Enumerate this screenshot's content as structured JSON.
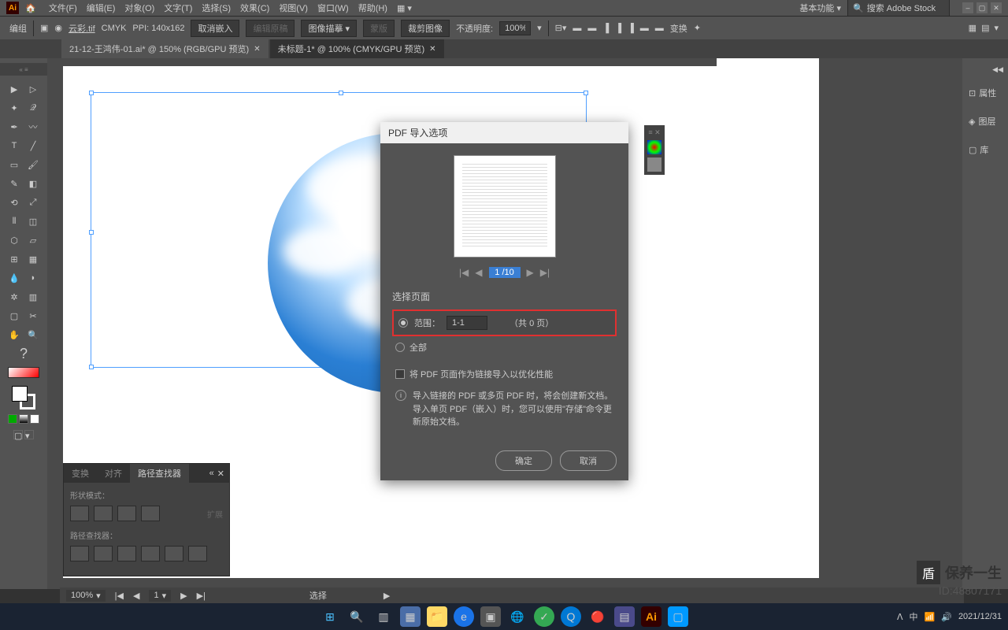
{
  "app": {
    "logo": "Ai"
  },
  "menus": [
    "文件(F)",
    "编辑(E)",
    "对象(O)",
    "文字(T)",
    "选择(S)",
    "效果(C)",
    "视图(V)",
    "窗口(W)",
    "帮助(H)"
  ],
  "titlebar": {
    "workspace": "基本功能",
    "search_placeholder": "搜索 Adobe Stock"
  },
  "controlbar": {
    "label": "编组",
    "filename": "云彩.tif",
    "colormode": "CMYK",
    "ppi": "PPI: 140x162",
    "cancel_embed": "取消嵌入",
    "edit_original": "编辑原稿",
    "image_desc": "图像描摹",
    "trace": "蒙版",
    "crop": "裁剪图像",
    "opacity_label": "不透明度:",
    "opacity_value": "100%",
    "transform": "变换"
  },
  "tabs": [
    {
      "label": "21-12-王鸿伟-01.ai* @ 150% (RGB/GPU 预览)",
      "active": false
    },
    {
      "label": "未标题-1* @ 100% (CMYK/GPU 预览)",
      "active": true
    }
  ],
  "right_panel": [
    {
      "icon": "properties",
      "label": "属性"
    },
    {
      "icon": "layers",
      "label": "图层"
    },
    {
      "icon": "library",
      "label": "库"
    }
  ],
  "dialog": {
    "title": "PDF 导入选项",
    "pager_value": "1 /10",
    "section_label": "选择页面",
    "range_label": "范围：",
    "range_value": "1-1",
    "range_total_prefix": "（共",
    "range_total_suffix": "0 页）",
    "all_label": "全部",
    "checkbox_label": "将 PDF 页面作为链接导入以优化性能",
    "info_line1": "导入链接的 PDF 或多页 PDF 时，将会创建新文档。",
    "info_line2": "导入单页 PDF（嵌入）时，您可以使用\"存储\"命令更新原始文档。",
    "ok": "确定",
    "cancel": "取消"
  },
  "pathfinder": {
    "tabs": [
      "变换",
      "对齐",
      "路径查找器"
    ],
    "shape_label": "形状模式：",
    "expand": "扩展",
    "pf_label": "路径查找器："
  },
  "statusbar": {
    "zoom": "100%",
    "page": "1",
    "select": "选择"
  },
  "watermark": {
    "title": "保养一生",
    "id": "ID:48807171"
  },
  "taskbar": {
    "time": "2021/12/31"
  }
}
